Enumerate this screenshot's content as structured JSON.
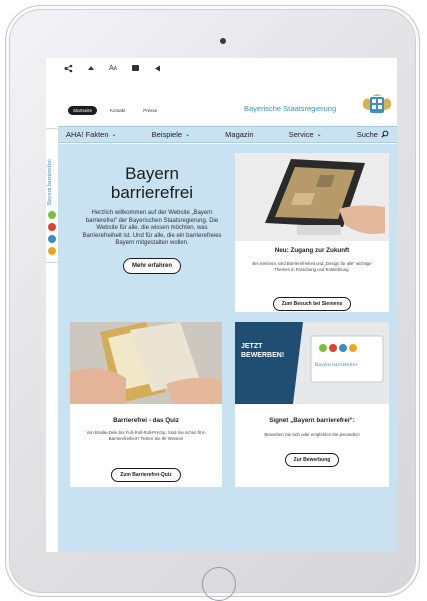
{
  "toolbar": {
    "icons": [
      "share-icon",
      "sign-language-icon",
      "text-size-icon",
      "easy-language-icon",
      "audio-icon"
    ],
    "text_size_label": "A",
    "text_size_label_small": "A"
  },
  "header": {
    "nav": [
      "Startseite",
      "Kontakt",
      "Presse"
    ],
    "brand": "Bayerische Staatsregierung"
  },
  "mainnav": {
    "items": [
      {
        "label": "AHA! Fakten",
        "chevron": true
      },
      {
        "label": "Beispiele",
        "chevron": true
      },
      {
        "label": "Magazin",
        "chevron": false
      },
      {
        "label": "Service",
        "chevron": true
      },
      {
        "label": "Suche",
        "search_icon": true
      }
    ]
  },
  "side_tab": {
    "label": "Bayern barrierefrei",
    "dots": [
      {
        "color": "#7bbf3c",
        "glyph": "♿"
      },
      {
        "color": "#e2412f",
        "glyph": "!"
      },
      {
        "color": "#3a8fc4",
        "glyph": "♿"
      },
      {
        "color": "#f2a51c",
        "glyph": "?"
      }
    ]
  },
  "hero": {
    "title_line1": "Bayern",
    "title_line2": "barrierefrei",
    "text": "Herzlich willkommen auf der Website „Bayern barrierefrei“ der Bayerischen Staatsregierung. Die Website für alle, die wissen möchten, was Barrierefreiheit ist. Und für alle, die ein barrierefreies Bayern mitgestalten wollen.",
    "button": "Mehr erfahren"
  },
  "cards": [
    {
      "title": "Neu: Zugang zur Zukunft",
      "text": "Bei Siemens sind Barrierefreiheit und „Design für alle“ wichtige Themen in Forschung und Entwicklung.",
      "button": "Zum Besuch bei Siemens"
    },
    {
      "title": "Barrierefrei - das Quiz",
      "text": "Von Braille-Zeile bis Fuß-Roll-Roll-Prinzip: Sind Sie schon fit in Barrierefreiheit? Testen Sie Ihr Wissen!",
      "button": "Zum Barrierefrei-Quiz"
    },
    {
      "title": "Signet „Bayern barrierefrei“:",
      "text": "Bewerben Sie sich oder empfehlen Sie jemanden!",
      "button": "Zur Bewerbung",
      "image_text_line1": "JETZT",
      "image_text_line2": "BEWERBEN!",
      "sign_text": "Bayern barrierefrei"
    }
  ],
  "colors": {
    "content_bg": "#c8e2f2",
    "brand_blue": "#3a8fc4",
    "navy_banner": "#1f4e72"
  }
}
